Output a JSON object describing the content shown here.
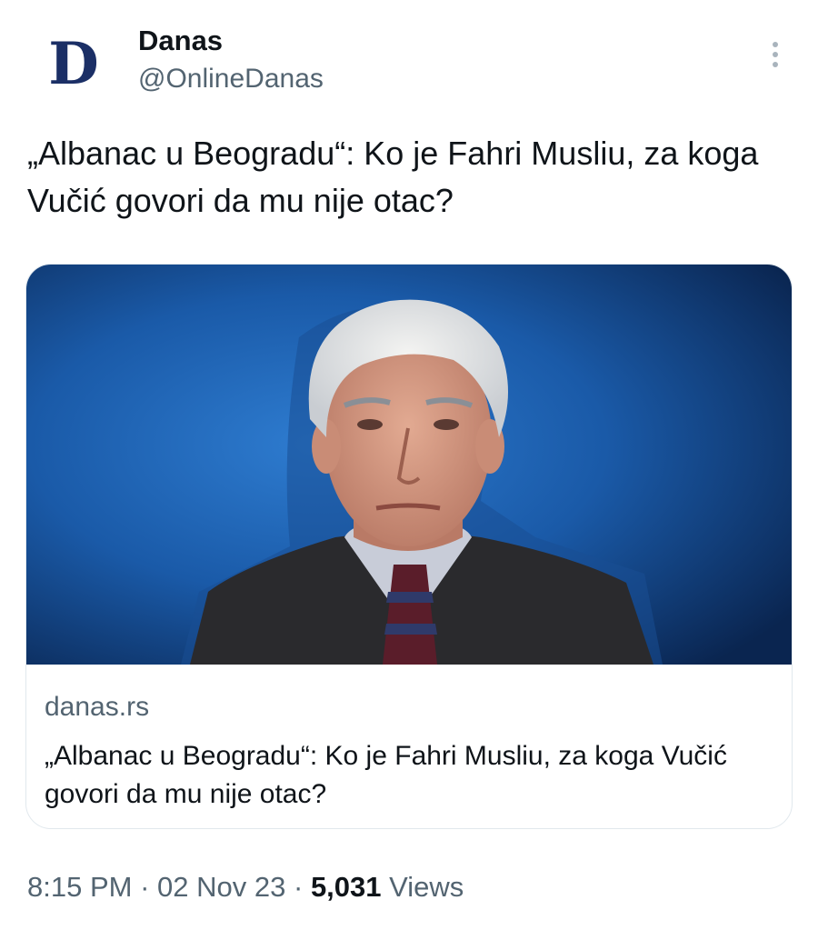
{
  "account": {
    "avatar_letter": "D",
    "display_name": "Danas",
    "handle": "@OnlineDanas"
  },
  "more_icon": "more-vertical-icon",
  "tweet": {
    "text": "„Albanac u Beogradu“: Ko je Fahri Musliu, za koga Vučić govori da mu nije otac?"
  },
  "link_card": {
    "image_description_icon": "article-photo",
    "domain": "danas.rs",
    "title": "„Albanac u Beogradu“: Ko je Fahri Musliu, za koga Vučić govori da mu nije otac?"
  },
  "meta": {
    "time": "8:15 PM",
    "separator": "·",
    "date": "02 Nov 23",
    "views_count": "5,031",
    "views_label": "Views"
  },
  "colors": {
    "brand_navy": "#1b2f66",
    "text_primary": "#0f1419",
    "text_secondary": "#536471",
    "card_border": "#e1e8ed",
    "photo_blue": "#1c5fb0"
  }
}
